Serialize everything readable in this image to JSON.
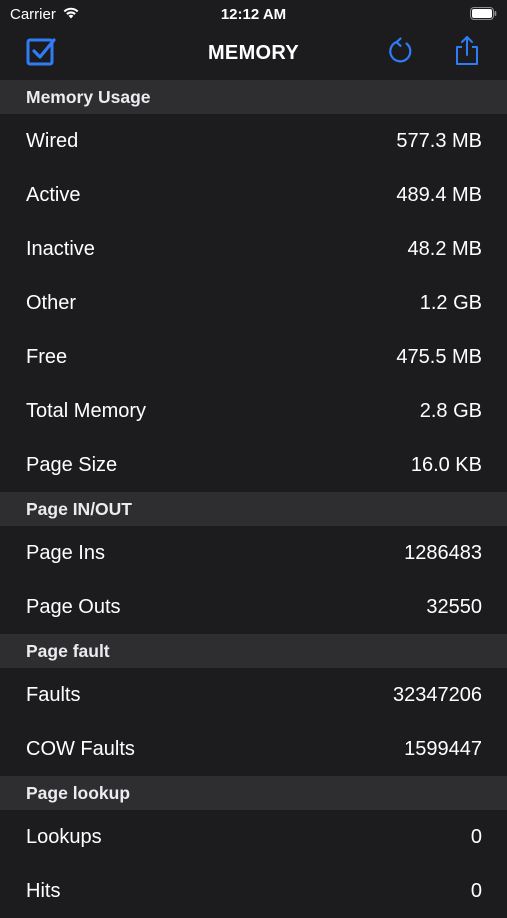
{
  "status_bar": {
    "carrier": "Carrier",
    "time": "12:12 AM"
  },
  "nav": {
    "title": "MEMORY",
    "left_icon": "checkbox-checked-icon",
    "refresh_icon": "refresh-icon",
    "share_icon": "share-icon",
    "accent_color": "#2f7cf6"
  },
  "sections": [
    {
      "header": "Memory Usage",
      "rows": [
        {
          "label": "Wired",
          "value": "577.3 MB"
        },
        {
          "label": "Active",
          "value": "489.4 MB"
        },
        {
          "label": "Inactive",
          "value": "48.2 MB"
        },
        {
          "label": "Other",
          "value": "1.2 GB"
        },
        {
          "label": "Free",
          "value": "475.5 MB"
        },
        {
          "label": "Total Memory",
          "value": "2.8 GB"
        },
        {
          "label": "Page Size",
          "value": "16.0 KB"
        }
      ]
    },
    {
      "header": "Page IN/OUT",
      "rows": [
        {
          "label": "Page Ins",
          "value": "1286483"
        },
        {
          "label": "Page Outs",
          "value": "32550"
        }
      ]
    },
    {
      "header": "Page fault",
      "rows": [
        {
          "label": "Faults",
          "value": "32347206"
        },
        {
          "label": "COW Faults",
          "value": "1599447"
        }
      ]
    },
    {
      "header": "Page lookup",
      "rows": [
        {
          "label": "Lookups",
          "value": "0"
        },
        {
          "label": "Hits",
          "value": "0"
        }
      ]
    }
  ]
}
